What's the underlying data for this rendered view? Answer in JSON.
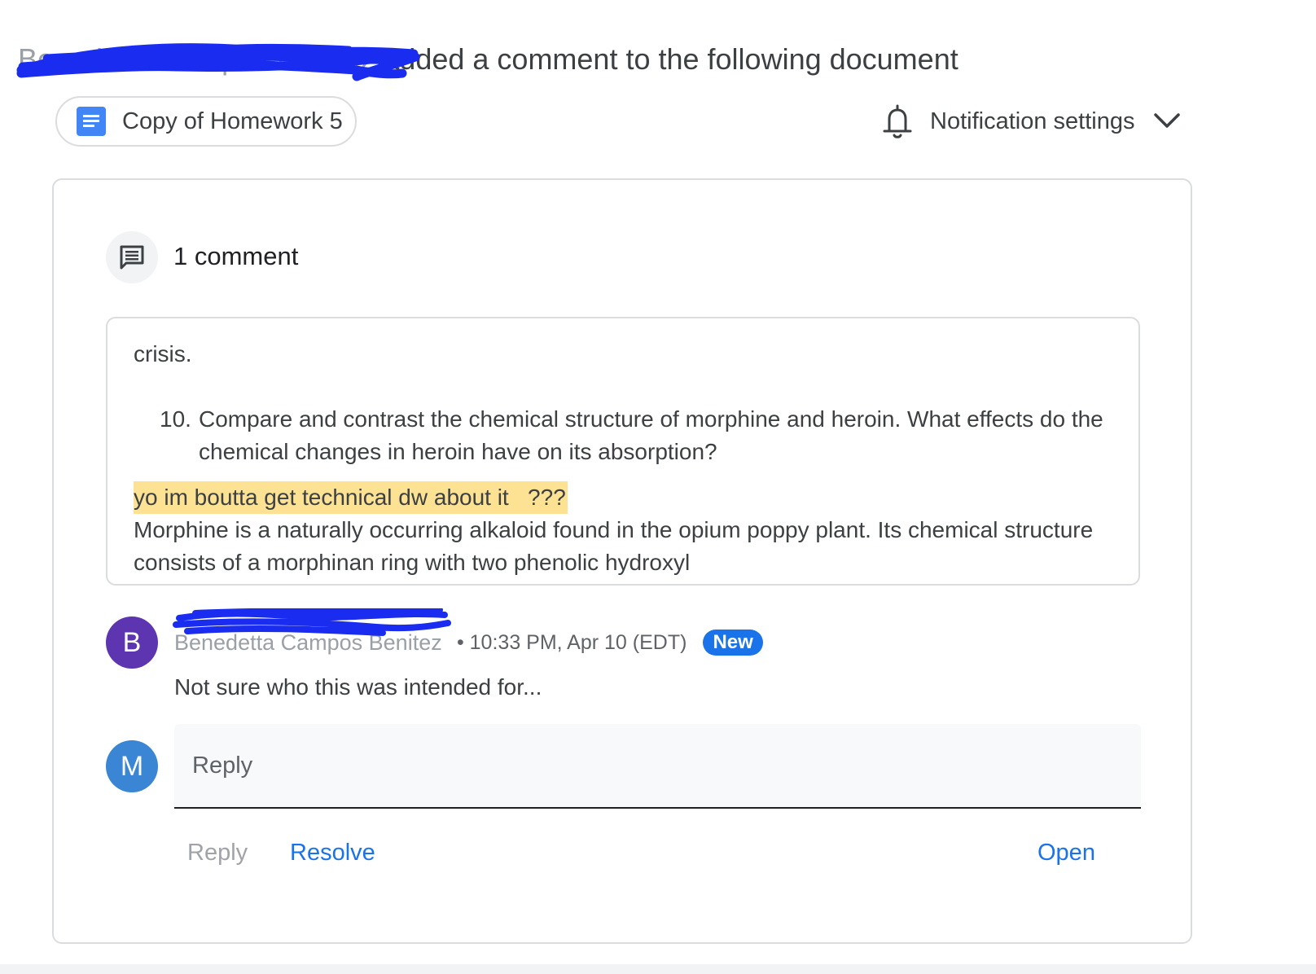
{
  "header": {
    "actor": "Benedetta Campos Benitez",
    "action_text": " added a comment to the following document"
  },
  "document": {
    "title": "Copy of Homework 5"
  },
  "notifications": {
    "label": "Notification settings"
  },
  "comments": {
    "count_label": "1 comment",
    "quote": {
      "line1": "crisis.",
      "item_number": "10.",
      "item_text": "Compare and contrast the chemical structure of morphine and heroin. What effects do the chemical changes in heroin have on its absorption?",
      "highlighted": "yo im boutta get technical dw about it   ???",
      "body": "Morphine is a naturally occurring alkaloid found in the opium poppy plant. Its chemical structure consists of a morphinan ring with two phenolic hydroxyl"
    },
    "thread": {
      "author_initial": "B",
      "author_name": "Benedetta Campos Benitez",
      "separator": " • ",
      "timestamp": "10:33 PM, Apr 10 (EDT)",
      "badge": "New",
      "text": "Not sure who this was intended for..."
    },
    "reply": {
      "avatar_initial": "M",
      "placeholder": "Reply"
    },
    "actions": {
      "reply": "Reply",
      "resolve": "Resolve",
      "open": "Open"
    }
  },
  "colors": {
    "avatar_b": "#5e35b1",
    "avatar_m": "#3a86d4",
    "link_blue": "#1a73e8",
    "highlight": "#fde293",
    "redaction_scribble": "#1a2cf0"
  }
}
